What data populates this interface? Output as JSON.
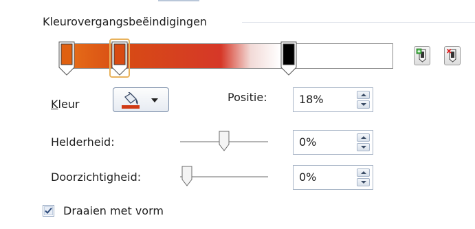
{
  "section": {
    "title": "Kleurovergangsbeëindigingen"
  },
  "gradient": {
    "stops": [
      {
        "name": "stop-1",
        "color": "#e06010",
        "selected": false
      },
      {
        "name": "stop-2",
        "color": "#d84a12",
        "selected": true
      },
      {
        "name": "stop-3",
        "color": "#000000",
        "selected": false
      }
    ],
    "add_stop_icon": "add-gradient-stop-icon",
    "remove_stop_icon": "remove-gradient-stop-icon"
  },
  "color": {
    "label": "Kleur",
    "accelerator": "K",
    "swatch": "#d03a14",
    "icon": "paint-bucket-icon"
  },
  "position": {
    "label": "Positie:",
    "value": "18%"
  },
  "brightness": {
    "label": "Helderheid:",
    "value": "0%",
    "level": 0.5
  },
  "transparency": {
    "label": "Doorzichtigheid:",
    "value": "0%",
    "level": 0.0
  },
  "rotate": {
    "label": "Draaien met vorm",
    "checked": true
  },
  "colors": {
    "accent_ring": "#e8b25c",
    "spin_border": "#a7b4c6"
  }
}
